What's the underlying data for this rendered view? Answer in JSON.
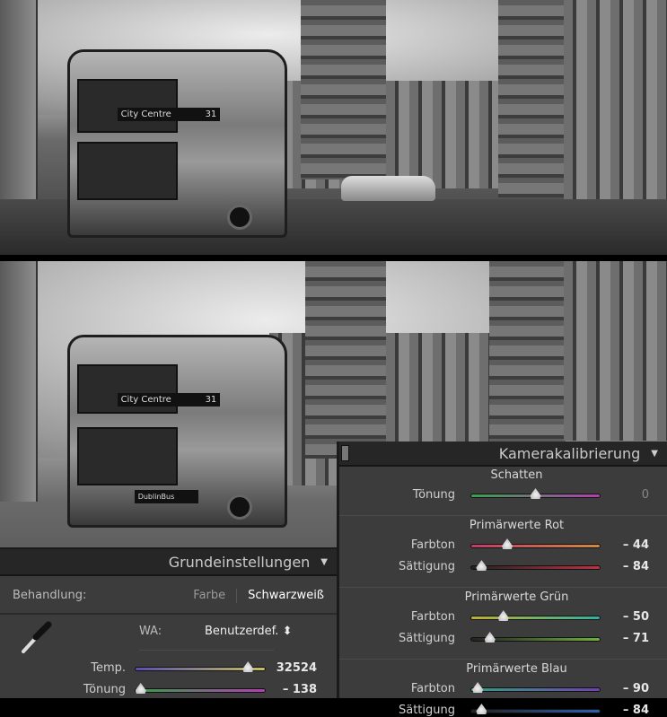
{
  "photos": {
    "bus_sign_text": "City Centre",
    "bus_route": "31",
    "bus_brand": "DublinBus"
  },
  "basic_panel": {
    "title": "Grundeinstellungen",
    "treatment_label": "Behandlung:",
    "treatment_color": "Farbe",
    "treatment_bw": "Schwarzweiß",
    "wb_label": "WA:",
    "wb_value": "Benutzerdef. ⬍",
    "sliders": [
      {
        "label": "Temp.",
        "value": "32524",
        "fraction": 0.87,
        "gradient": [
          "#5a4fb0",
          "#c8c060"
        ]
      },
      {
        "label": "Tönung",
        "value": "– 138",
        "fraction": 0.04,
        "gradient": [
          "#3a9a4a",
          "#b040b0"
        ]
      }
    ]
  },
  "calibration_panel": {
    "title": "Kamerakalibrierung",
    "groups": [
      {
        "title": "Schatten",
        "sliders": [
          {
            "label": "Tönung",
            "value": "0",
            "num": 0,
            "gradient": [
              "#3aa050",
              "#b040b0"
            ],
            "dim": true
          }
        ]
      },
      {
        "title": "Primärwerte Rot",
        "sliders": [
          {
            "label": "Farbton",
            "value": "– 44",
            "num": -44,
            "gradient": [
              "#c03a6a",
              "#d08a40"
            ]
          },
          {
            "label": "Sättigung",
            "value": "– 84",
            "num": -84,
            "gradient": [
              "#222",
              "#c03040"
            ]
          }
        ]
      },
      {
        "title": "Primärwerte Grün",
        "sliders": [
          {
            "label": "Farbton",
            "value": "– 50",
            "num": -50,
            "gradient": [
              "#c0b030",
              "#30b0a0"
            ]
          },
          {
            "label": "Sättigung",
            "value": "– 71",
            "num": -71,
            "gradient": [
              "#222",
              "#70b040"
            ]
          }
        ]
      },
      {
        "title": "Primärwerte Blau",
        "sliders": [
          {
            "label": "Farbton",
            "value": "– 90",
            "num": -90,
            "gradient": [
              "#30a080",
              "#7040b0"
            ]
          },
          {
            "label": "Sättigung",
            "value": "– 84",
            "num": -84,
            "gradient": [
              "#222",
              "#3060b0"
            ]
          }
        ]
      }
    ]
  }
}
